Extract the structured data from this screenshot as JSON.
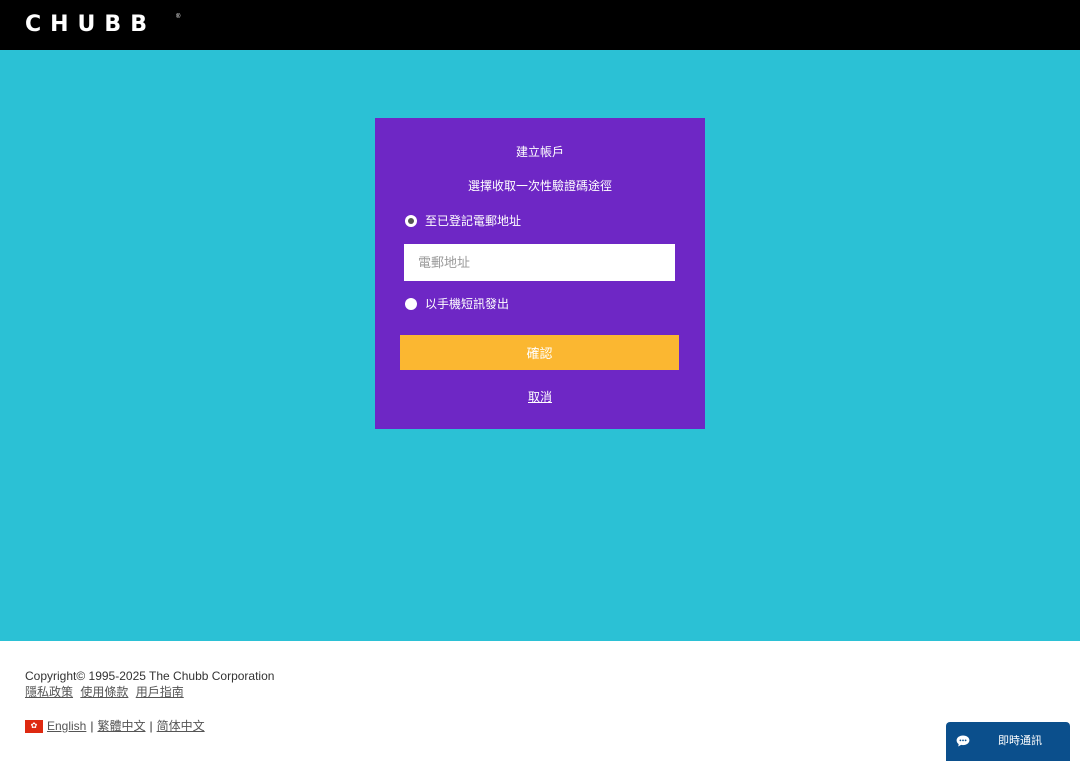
{
  "header": {
    "logo_text": "CHUBB",
    "logo_mark": "®"
  },
  "card": {
    "title": "建立帳戶",
    "subtitle": "選擇收取一次性驗證碼途徑",
    "options": [
      {
        "label": "至已登記電郵地址",
        "checked": true
      },
      {
        "label": "以手機短訊發出",
        "checked": false
      }
    ],
    "email_placeholder": "電郵地址",
    "email_value": "",
    "confirm_label": "確認",
    "cancel_label": "取消"
  },
  "footer": {
    "copyright": "Copyright© 1995-2025 The Chubb Corporation",
    "links": [
      "隱私政策",
      "使用條款",
      "用戶指南"
    ],
    "flag_icon": "hong-kong-flag-icon",
    "languages": [
      "English",
      "繁體中文",
      "简体中文"
    ],
    "separator": "|"
  },
  "chat": {
    "label": "即時通訊",
    "icon": "chat-bubble-icon"
  },
  "colors": {
    "topbar": "#000000",
    "background": "#2bc1d5",
    "card": "#6e27c5",
    "button": "#fbb731",
    "chat": "#0b4f8c"
  }
}
